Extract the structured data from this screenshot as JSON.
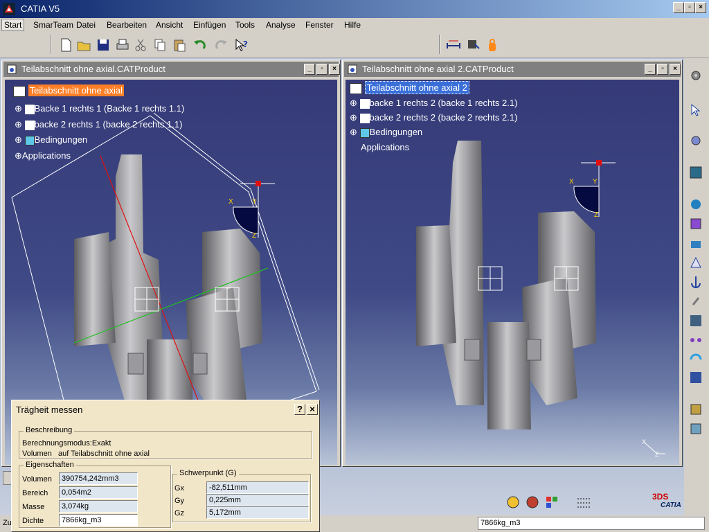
{
  "app": {
    "title": "CATIA V5"
  },
  "menu": [
    "Start",
    "SmarTeam",
    "Datei",
    "Bearbeiten",
    "Ansicht",
    "Einfügen",
    "Tools",
    "Analyse",
    "Fenster",
    "Hilfe"
  ],
  "windows": {
    "left": {
      "title": "Teilabschnitt ohne axial.CATProduct",
      "tree": {
        "root": "Teilabschnitt ohne axial",
        "item1": "Backe 1 rechts 1 (Backe 1 rechts 1.1)",
        "item2": "backe 2 rechts 1 (backe 2 rechts 1.1)",
        "item3": "Bedingungen",
        "item4": "Applications"
      }
    },
    "right": {
      "title": "Teilabschnitt ohne axial 2.CATProduct",
      "tree": {
        "root": "Teilabschnitt ohne axial 2",
        "item1": "backe 1 rechts 2 (backe 1 rechts 2.1)",
        "item2": "backe 2 rechts 2 (backe 2 rechts 2.1)",
        "item3": "Bedingungen",
        "item4": "Applications"
      }
    }
  },
  "axes": {
    "x": "X",
    "y": "Y",
    "z": "Z"
  },
  "dialog": {
    "title": "Trägheit messen",
    "help": "?",
    "close": "×",
    "beschreibung": {
      "label": "Beschreibung",
      "modus": "Berechnungsmodus:Exakt",
      "volumen_label": "Volumen",
      "volumen_value": "auf Teilabschnitt ohne axial"
    },
    "eigenschaften": {
      "label": "Eigenschaften",
      "rows": [
        {
          "label": "Volumen",
          "value": "390754,242mm3"
        },
        {
          "label": "Bereich",
          "value": "0,054m2"
        },
        {
          "label": "Masse",
          "value": "3,074kg"
        },
        {
          "label": "Dichte",
          "value": "7866kg_m3"
        }
      ]
    },
    "schwerpunkt": {
      "label": "Schwerpunkt (G)",
      "rows": [
        {
          "label": "Gx",
          "value": "-82,511mm"
        },
        {
          "label": "Gy",
          "value": "0,225mm"
        },
        {
          "label": "Gz",
          "value": "5,172mm"
        }
      ]
    }
  },
  "status": {
    "left": "Zu",
    "input": "7866kg_m3"
  },
  "brand": {
    "name": "CATIA",
    "logo": "3DS"
  },
  "colors": {
    "highlight": "#ff7f27",
    "selection": "#3a6fd8"
  }
}
